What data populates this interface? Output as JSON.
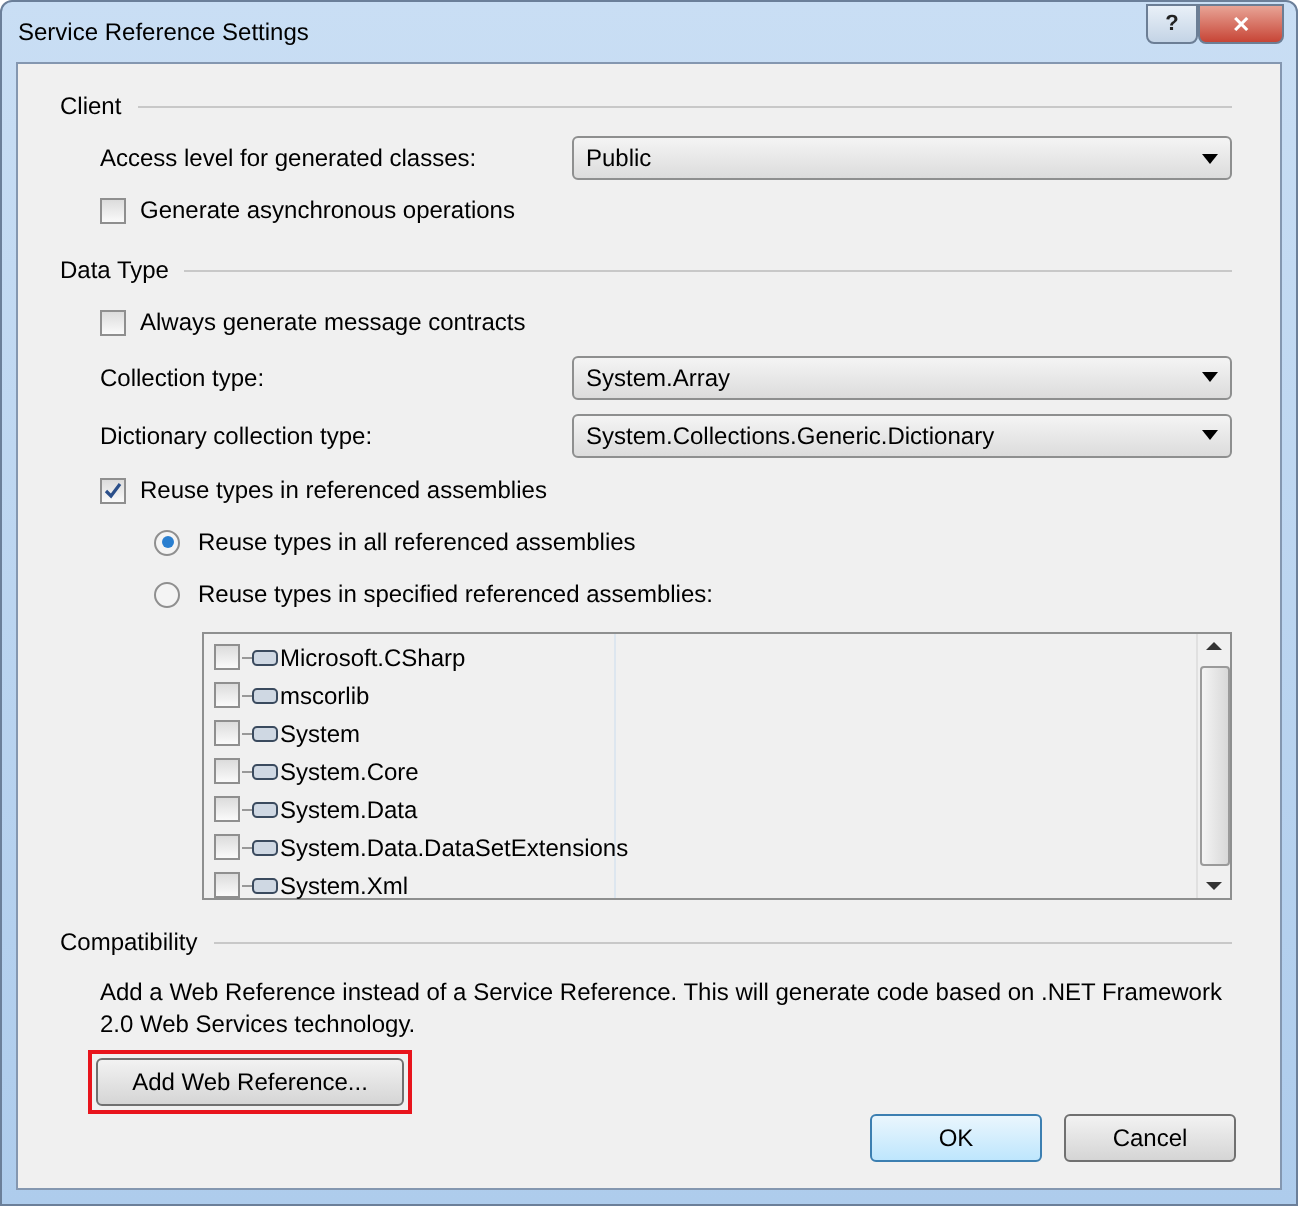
{
  "window": {
    "title": "Service Reference Settings",
    "buttons": [
      {
        "kind": "help",
        "label": "?"
      },
      {
        "kind": "close",
        "label": "✕"
      }
    ]
  },
  "client": {
    "heading": "Client",
    "access_level": {
      "label": "Access level for generated classes:",
      "value": "Public"
    },
    "async": {
      "label": "Generate asynchronous operations",
      "checked": false
    }
  },
  "data_type": {
    "heading": "Data Type",
    "message_contracts": {
      "label": "Always generate message contracts",
      "checked": false
    },
    "collection_type": {
      "label": "Collection type:",
      "value": "System.Array"
    },
    "dictionary_type": {
      "label": "Dictionary collection type:",
      "value": "System.Collections.Generic.Dictionary"
    },
    "reuse_types": {
      "label": "Reuse types in referenced assemblies",
      "checked": true
    },
    "reuse_options": [
      {
        "label": "Reuse types in all referenced assemblies",
        "selected": true
      },
      {
        "label": "Reuse types in specified referenced assemblies:",
        "selected": false
      }
    ],
    "assemblies": [
      {
        "name": "Microsoft.CSharp",
        "checked": false
      },
      {
        "name": "mscorlib",
        "checked": false
      },
      {
        "name": "System",
        "checked": false
      },
      {
        "name": "System.Core",
        "checked": false
      },
      {
        "name": "System.Data",
        "checked": false
      },
      {
        "name": "System.Data.DataSetExtensions",
        "checked": false
      },
      {
        "name": "System.Xml",
        "checked": false
      }
    ]
  },
  "compatibility": {
    "heading": "Compatibility",
    "description": "Add a Web Reference instead of a Service Reference. This will generate code based on .NET Framework 2.0 Web Services technology.",
    "button": {
      "label": "Add Web Reference...",
      "highlighted": true
    }
  },
  "buttons": [
    {
      "label": "OK",
      "default": true
    },
    {
      "label": "Cancel",
      "default": false
    }
  ]
}
